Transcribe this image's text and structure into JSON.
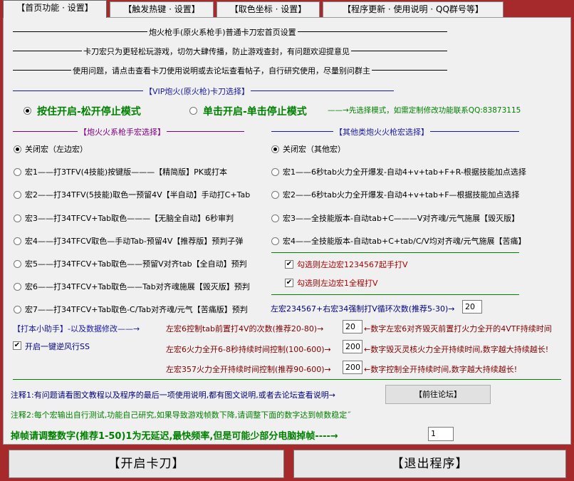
{
  "tabs": [
    "【首页功能 · 设置】",
    "【触发热键 · 设置】",
    "【取色坐标 · 设置】",
    "【程序更新 · 使用说明 · QQ群号等】"
  ],
  "headings": {
    "main_title": "炮火枪手(原火系枪手)普通卡刀宏首页设置",
    "notice1": "卡刀宏只为更轻松玩游戏，切勿大肆传播，防止游戏查封，有问题欢迎提意见",
    "notice2": "使用问题，请点击查看卡刀使用说明或去论坛查看帖子，自行研究使用，尽量别问群主",
    "vip": "【VIP炮火(原火枪)卡刀选择】",
    "left_group": "【炮火火系枪手宏选择】",
    "right_group": "【其他类炮火火枪宏选择】",
    "helper": "【打本小助手】-以及数据修改"
  },
  "mode": {
    "option1": "按住开启-松开停止模式",
    "option2": "单击开启-单击停止模式",
    "note": "先选择模式，如需定制修改功能联系QQ:83873115"
  },
  "left_macros": [
    "关闭宏（左边宏）",
    "宏1——打3TFV(4技能)按键版———【精简版】PK或打本",
    "宏2——打34TFV(5技能)取色一预留4V【半自动】手动打C+Tab",
    "宏3——打34TFCV+Tab取色———【无脑全自动】6秒审判",
    "宏4——打34TFCV取色—手动Tab-预留4V【推荐版】预判子弹",
    "宏5——打34TFCV+Tab取色——预留V对齐tab【全自动】预判",
    "宏6——打34TFCV+Tab取色——Tab对齐魂施展【毁灭版】预判",
    "宏7——打34TFCV+Tab取色-C/Tab对齐魂/元气【苦痛版】预判"
  ],
  "right_macros": [
    "关闭宏（其他宏）",
    "宏1——6秒tab火力全开爆发-自动4+v+tab+F+R-根据技能加点选择",
    "宏2——6秒tab火力全开爆发-自动4+v+tab+F—根据技能加点选择",
    "宏3——全技能版本-自动tab+C———V对齐魂/元气施展【毁灭版】",
    "宏4——全技能版本-自动tab+C+tab/C/V均对齐魂/元气施展【苦痛】"
  ],
  "checks": {
    "left_1234567": "勾选则左边宏1234567起手打V",
    "left_1": "勾选则左边宏1全程打V",
    "reverse_ss": "开启一键逆风行SS"
  },
  "loop": {
    "label": "左宏234567+右宏34强制打V循环次数(推荐5-30)",
    "value": "20"
  },
  "params": [
    {
      "label": "左宏6控制tab前置打4V的次数(推荐20-80)",
      "value": "20",
      "note": "数字左宏6对齐毁灭前置打火力全开的4VTF持续时间"
    },
    {
      "label": "左宏6火力全开6-8秒持续时间控制(100-600)",
      "value": "200",
      "note": "数字毁灭灵核火力全开持续时间,数字越大持续越长!"
    },
    {
      "label": "左宏357火力全开持续时间控制(推荐90-600)",
      "value": "200",
      "note": "数字控制全开持续时间,数字越大持续越长!"
    }
  ],
  "notes": {
    "note1": "注释1:有问题请看图文教程以及程序的最后一项使用说明,都有图文说明,或者去论坛查看说明",
    "forum_button": "【前往论坛】",
    "note2": "注释2:每个宏输出自行测试,功能自己研究,如果导致游戏帧数下降,请调整下面的数字达到帧数稳定˝",
    "frame_label": "掉帧请调整数字(推荐1-50)1为无延迟,最快频率,但是可能少部分电脑掉帧----",
    "frame_value": "1"
  },
  "buttons": {
    "start": "【开启卡刀】",
    "exit": "【退出程序】"
  }
}
